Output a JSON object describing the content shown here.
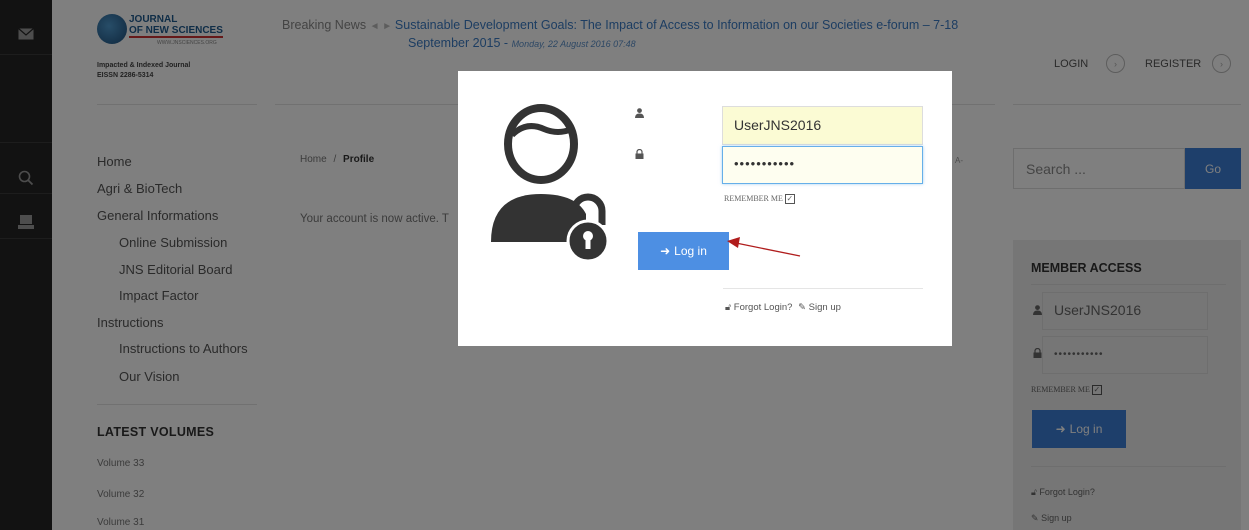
{
  "journal": {
    "name_line1": "JOURNAL",
    "name_line2": "OF NEW SCIENCES",
    "website": "WWW.JNSCIENCES.ORG",
    "tagline": "Impacted & Indexed Journal",
    "issn": "EISSN 2286-5314"
  },
  "breaking_news": {
    "label": "Breaking News",
    "headline_part1": "Sustainable Development Goals: The Impact of Access to Information on our Societies e-forum – 7-18",
    "headline_part2": "September 2015",
    "date": "Monday, 22 August 2016 07:48"
  },
  "auth": {
    "login": "LOGIN",
    "register": "REGISTER"
  },
  "menu": [
    {
      "label": "Home"
    },
    {
      "label": "Agri & BioTech"
    },
    {
      "label": "General Informations"
    },
    {
      "label": "Online Submission"
    },
    {
      "label": "JNS Editorial Board"
    },
    {
      "label": "Impact Factor"
    },
    {
      "label": "Instructions"
    },
    {
      "label": "Instructions to Authors"
    },
    {
      "label": "Our Vision"
    }
  ],
  "latest_volumes": {
    "title": "LATEST VOLUMES",
    "items": [
      "Volume 33",
      "Volume 32",
      "Volume 31"
    ]
  },
  "breadcrumb": {
    "home": "Home",
    "sep": "/",
    "current": "Profile"
  },
  "main": {
    "message": "Your account is now active. T",
    "fragment": "A-"
  },
  "search": {
    "placeholder": "Search ...",
    "button": "Go"
  },
  "member_access": {
    "title": "MEMBER ACCESS",
    "username": "UserJNS2016",
    "password": "•••••••••••",
    "remember": "REMEMBER ME",
    "login_button": "Log in",
    "forgot": "Forgot Login?",
    "signup": "Sign up"
  },
  "modal": {
    "username": "UserJNS2016",
    "password": "•••••••••••",
    "remember": "REMEMBER ME",
    "login_button": "Log in",
    "forgot": "Forgot Login?",
    "signup": "Sign up"
  },
  "colors": {
    "primary_button": "#3c7fd6",
    "annotation_arrow": "#b01c1c",
    "link": "#3a7bc4"
  }
}
